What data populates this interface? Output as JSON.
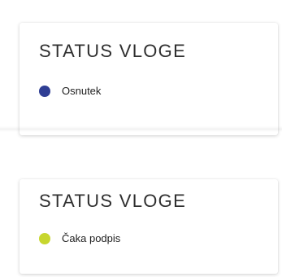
{
  "cards": [
    {
      "title": "STATUS VLOGE",
      "status": "Osnutek",
      "status_color": "#2F3E94"
    },
    {
      "title": "STATUS VLOGE",
      "status": "Čaka podpis",
      "status_color": "#C7D62E"
    }
  ]
}
